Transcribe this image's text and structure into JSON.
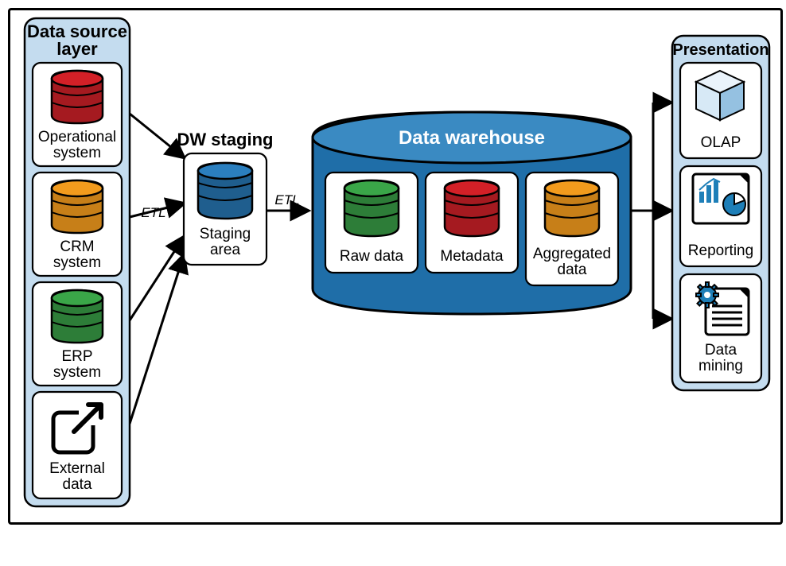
{
  "panels": {
    "source": {
      "title1": "Data source",
      "title2": "layer"
    },
    "staging": {
      "title": "DW staging"
    },
    "warehouse": {
      "title": "Data warehouse"
    },
    "presentation": {
      "title": "Presentation"
    }
  },
  "sources": {
    "op1": "Operational",
    "op2": "system",
    "crm1": "CRM",
    "crm2": "system",
    "erp1": "ERP",
    "erp2": "system",
    "ext1": "External",
    "ext2": "data"
  },
  "staging": {
    "area1": "Staging",
    "area2": "area"
  },
  "warehouse": {
    "raw": "Raw data",
    "meta": "Metadata",
    "agg1": "Aggregated",
    "agg2": "data"
  },
  "presentation": {
    "olap": "OLAP",
    "report": "Reporting",
    "mine1": "Data",
    "mine2": "mining"
  },
  "etl": {
    "label": "ETL"
  },
  "colors": {
    "red": {
      "top": "#d32027",
      "side": "#a51a20"
    },
    "orange": {
      "top": "#f29b1d",
      "side": "#c77f18"
    },
    "green": {
      "top": "#3aa648",
      "side": "#2d7d38"
    },
    "blue": {
      "top": "#2b7fbf",
      "side": "#1f5e8e"
    },
    "wareTop": "#3a8ac2",
    "wareSide": "#1f6ea8",
    "cubeLt": "#d7e9f6",
    "cubeRt": "#95c1e1",
    "cubeTp": "#eaf3fb",
    "gear": "#1e7fb8",
    "pie": "#1e7fb8"
  }
}
